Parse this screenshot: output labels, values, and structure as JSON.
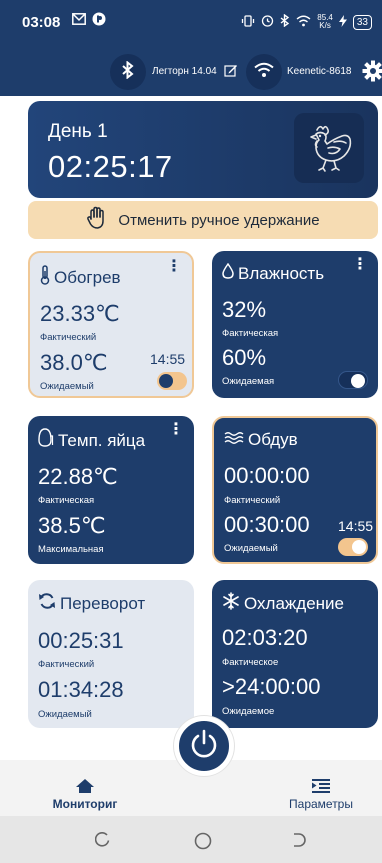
{
  "status_bar": {
    "time": "03:08",
    "battery": "33",
    "net_speed_top": "85.4",
    "net_speed_bottom": "K/s"
  },
  "connection": {
    "device_label": "Легторн 14.04",
    "wifi_label": "Keenetic-8618"
  },
  "day_card": {
    "label": "День 1",
    "time": "02:25:17"
  },
  "manual_hold": {
    "label": "Отменить ручное удержание"
  },
  "cards": {
    "heating": {
      "title": "Обогрев",
      "actual_value": "23.33℃",
      "actual_label": "Фактический",
      "target_value": "38.0℃",
      "target_label": "Ожидаемый",
      "time": "14:55",
      "toggle_on": true
    },
    "humidity": {
      "title": "Влажность",
      "actual_value": "32%",
      "actual_label": "Фактическая",
      "target_value": "60%",
      "target_label": "Ожидаемая",
      "toggle_on": true
    },
    "egg_temp": {
      "title": "Темп. яйца",
      "actual_value": "22.88℃",
      "actual_label": "Фактическая",
      "target_value": "38.5℃",
      "target_label": "Максимальная"
    },
    "airflow": {
      "title": "Обдув",
      "actual_value": "00:00:00",
      "actual_label": "Фактический",
      "target_value": "00:30:00",
      "target_label": "Ожидаемый",
      "time": "14:55",
      "toggle_on": true
    },
    "turning": {
      "title": "Переворот",
      "actual_value": "00:25:31",
      "actual_label": "Фактический",
      "target_value": "01:34:28",
      "target_label": "Ожидаемый"
    },
    "cooling": {
      "title": "Охлаждение",
      "actual_value": "02:03:20",
      "actual_label": "Фактическое",
      "target_value": ">24:00:00",
      "target_label": "Ожидаемое"
    }
  },
  "bottom_nav": {
    "monitoring_label": "Мониториг",
    "settings_label": "Параметры"
  },
  "colors": {
    "navy": "#1e3d6b",
    "light_card": "#e3e8f0",
    "accent_orange": "#f6dcb3",
    "toggle_on": "#f3c58e"
  }
}
